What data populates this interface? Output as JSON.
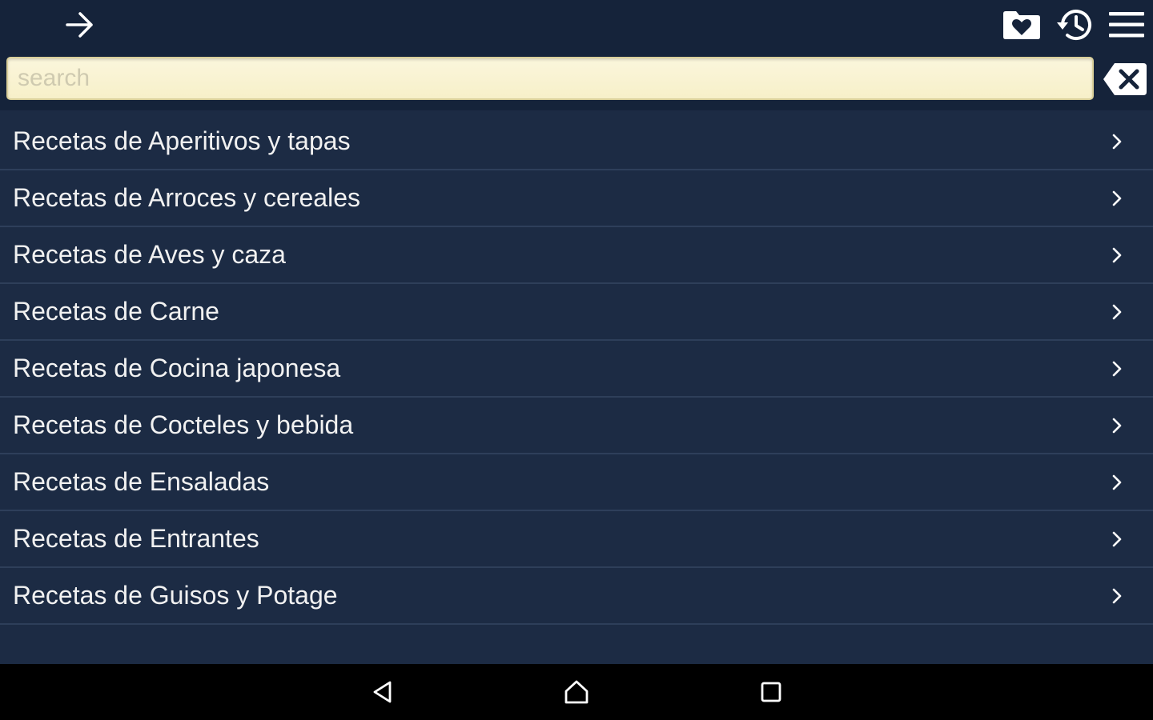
{
  "app_bar": {
    "forward_icon": "arrow-right-icon",
    "favorites_icon": "heart-folder-icon",
    "history_icon": "history-icon",
    "menu_icon": "hamburger-menu-icon"
  },
  "search": {
    "placeholder": "search",
    "value": "",
    "clear_icon": "backspace-clear-icon"
  },
  "categories": [
    {
      "label": "Recetas de Aperitivos y tapas"
    },
    {
      "label": "Recetas de Arroces y cereales"
    },
    {
      "label": "Recetas de Aves y caza"
    },
    {
      "label": "Recetas de Carne"
    },
    {
      "label": "Recetas de Cocina japonesa"
    },
    {
      "label": "Recetas de Cocteles y bebida"
    },
    {
      "label": "Recetas de Ensaladas"
    },
    {
      "label": "Recetas de Entrantes"
    },
    {
      "label": "Recetas de Guisos y Potage"
    }
  ],
  "nav_bar": {
    "back_icon": "back-triangle-icon",
    "home_icon": "home-icon",
    "recents_icon": "recents-square-icon"
  },
  "colors": {
    "background": "#1c2b44",
    "app_bar": "#15233a",
    "text": "#f1f1f1",
    "search_field": "#fbf6dc",
    "nav_bar": "#000000"
  }
}
